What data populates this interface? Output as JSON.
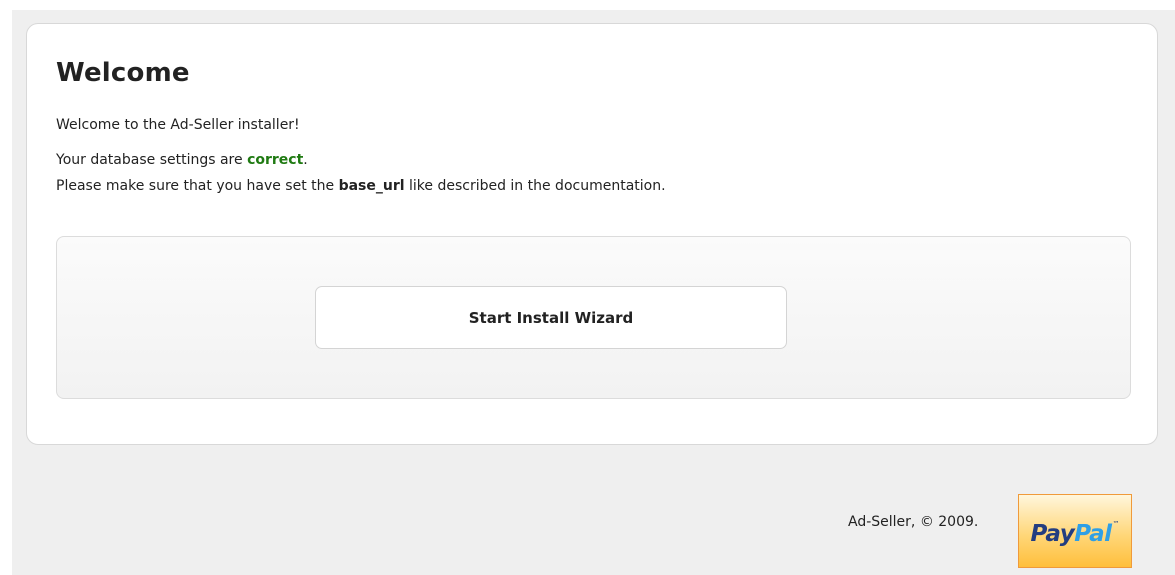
{
  "main": {
    "title": "Welcome",
    "intro": "Welcome to the Ad-Seller installer!",
    "db_status_prefix": "Your database settings are ",
    "db_status_value": "correct",
    "db_status_suffix": ".",
    "base_url_prefix": "Please make sure that you have set the ",
    "base_url_key": "base_url",
    "base_url_suffix": " like described in the documentation.",
    "wizard_button_label": "Start Install Wizard"
  },
  "footer": {
    "copyright": "Ad-Seller, © 2009.",
    "paypal_pay": "Pay",
    "paypal_pal": "Pal",
    "paypal_tm": "™"
  },
  "colors": {
    "status_ok": "#1f7a12",
    "paypal_dark_blue": "#233d80",
    "paypal_light_blue": "#2e9fe6",
    "paypal_border": "#f09a3a"
  }
}
